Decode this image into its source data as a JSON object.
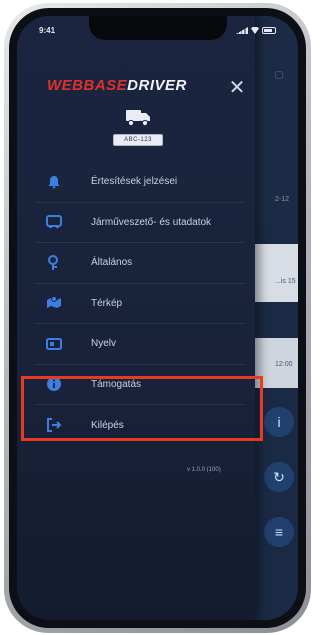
{
  "status_bar": {
    "time": "9:41"
  },
  "brand": {
    "part1": "WEBBASE",
    "part2": "DRIVER"
  },
  "vehicle": {
    "plate": "ABC-123"
  },
  "menu": {
    "items": [
      {
        "label": "Értesítések jelzései",
        "icon": "bell-icon"
      },
      {
        "label": "Járműveszető- és utadatok",
        "icon": "truck-icon"
      },
      {
        "label": "Általános",
        "icon": "settings-icon"
      },
      {
        "label": "Térkép",
        "icon": "map-icon"
      },
      {
        "label": "Nyelv",
        "icon": "language-icon"
      },
      {
        "label": "Támogatás",
        "icon": "info-icon"
      },
      {
        "label": "Kilépés",
        "icon": "logout-icon"
      }
    ]
  },
  "version": "v 1.0.0 (100)",
  "background": {
    "time_a": "2-12",
    "time_b": "12:00",
    "card_text": "...is 15"
  },
  "colors": {
    "accent": "#3d7fe0",
    "brand_red": "#e0302a",
    "highlight": "#e83a23"
  }
}
